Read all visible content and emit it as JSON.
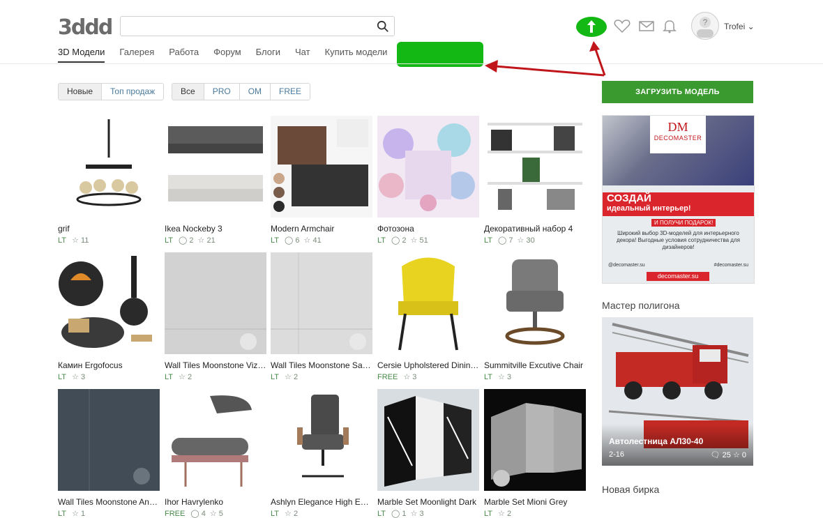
{
  "header": {
    "logo": "3ddd",
    "search_placeholder": "",
    "nav": [
      "3D Модели",
      "Галерея",
      "Работа",
      "Форум",
      "Блоги",
      "Чат",
      "Купить модели"
    ],
    "username": "Trofei",
    "upload_button": "ЗАГРУЗИТЬ МОДЕЛЬ",
    "accent": "#14b814"
  },
  "filters": {
    "sort": [
      "Новые",
      "Топ продаж"
    ],
    "type": [
      "Все",
      "PRO",
      "OM",
      "FREE"
    ]
  },
  "grid": [
    {
      "title": "grif",
      "tag": "LT",
      "comments": "",
      "stars": "11"
    },
    {
      "title": "Ikea Nockeby 3",
      "tag": "LT",
      "comments": "2",
      "stars": "21"
    },
    {
      "title": "Modern Armchair",
      "tag": "LT",
      "comments": "6",
      "stars": "41"
    },
    {
      "title": "Фотозона",
      "tag": "LT",
      "comments": "2",
      "stars": "51"
    },
    {
      "title": "Декоративный набор 4",
      "tag": "LT",
      "comments": "7",
      "stars": "30"
    },
    {
      "title": "Камин Ergofocus",
      "tag": "LT",
      "comments": "",
      "stars": "3"
    },
    {
      "title": "Wall Tiles Moonstone Vizion",
      "tag": "LT",
      "comments": "",
      "stars": "2"
    },
    {
      "title": "Wall Tiles Moonstone Sandstone",
      "tag": "LT",
      "comments": "",
      "stars": "2"
    },
    {
      "title": "Cersie Upholstered Dining Chair",
      "tag": "FREE",
      "comments": "",
      "stars": "3"
    },
    {
      "title": "Summitville Excutive Chair",
      "tag": "LT",
      "comments": "",
      "stars": "3"
    },
    {
      "title": "Wall Tiles Moonstone Anthracite",
      "tag": "LT",
      "comments": "",
      "stars": "1"
    },
    {
      "title": "Ihor Havrylenko",
      "tag": "FREE",
      "comments": "4",
      "stars": "5"
    },
    {
      "title": "Ashlyn Elegance High Executive",
      "tag": "LT",
      "comments": "",
      "stars": "2"
    },
    {
      "title": "Marble Set Moonlight Dark",
      "tag": "LT",
      "comments": "1",
      "stars": "3"
    },
    {
      "title": "Marble Set Mioni Grey",
      "tag": "LT",
      "comments": "",
      "stars": "2"
    }
  ],
  "sidebar": {
    "banner": {
      "brand": "DECOMASTER",
      "headline": "СОЗДАЙ",
      "headline2": "идеальный интерьер!",
      "gift": "И ПОЛУЧИ ПОДАРОК!",
      "body": "Широкий выбор 3D-моделей для интерьерного декора! Выгодные условия сотрудничества для дизайнеров!",
      "tag1": "@decomaster.su",
      "tag2": "#decomaster.su",
      "site": "decomaster.su"
    },
    "master_title": "Мастер полигона",
    "feature": {
      "title": "Автолестница АЛ30-40",
      "date": "2-16",
      "comments": "25",
      "stars": "0"
    },
    "new_tag_title": "Новая бирка"
  }
}
